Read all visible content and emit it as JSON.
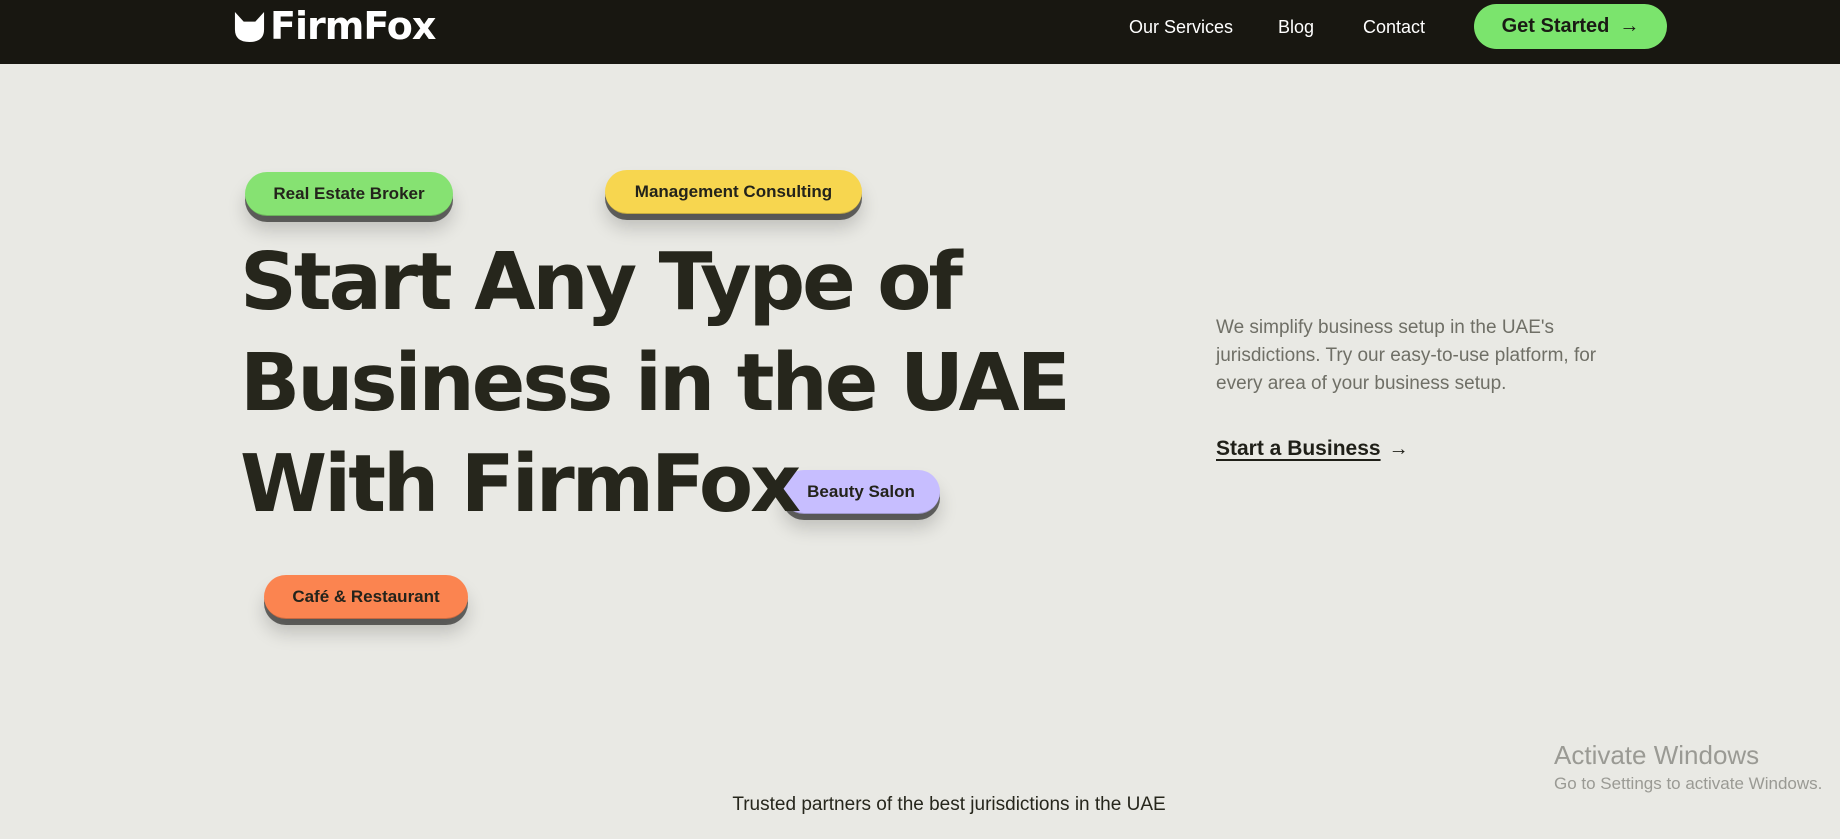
{
  "header": {
    "logo_text": "FirmFox",
    "logo_icon": "fox-head-icon",
    "nav": [
      {
        "label": "Our Services"
      },
      {
        "label": "Blog"
      },
      {
        "label": "Contact"
      }
    ],
    "cta_label": "Get Started",
    "cta_icon": "arrow-right-icon"
  },
  "hero": {
    "tags": [
      {
        "label": "Real Estate Broker",
        "color": "#86e272"
      },
      {
        "label": "Management Consulting",
        "color": "#f7d64f"
      },
      {
        "label": "Beauty Salon",
        "color": "#c7beff"
      },
      {
        "label": "Café & Restaurant",
        "color": "#fb8450"
      }
    ],
    "headline_lines": [
      "Start Any Type of",
      "Business in the UAE",
      "With FirmFox"
    ],
    "description": "We simplify business setup in the UAE's jurisdictions. Try our easy-to-use platform, for every area of your business setup.",
    "link_label": "Start a Business",
    "link_icon": "arrow-right-icon"
  },
  "footer": {
    "trusted_text": "Trusted partners of the best jurisdictions in the UAE"
  },
  "watermark": {
    "title": "Activate Windows",
    "subtitle": "Go to Settings to activate Windows."
  },
  "colors": {
    "background": "#e9e9e4",
    "header_bg": "#181711",
    "accent_green": "#7be46d",
    "text_dark": "#26261c"
  }
}
